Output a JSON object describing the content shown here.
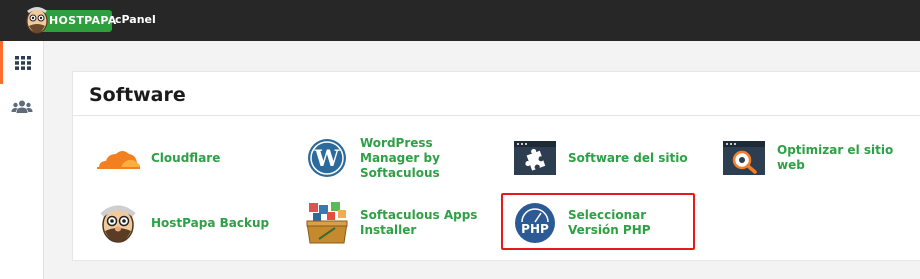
{
  "topbar": {
    "logo_text": "HOSTPAPA",
    "product": "cPanel"
  },
  "sidebar": {
    "items": [
      {
        "icon": "grid-icon",
        "active": true
      },
      {
        "icon": "users-icon",
        "active": false
      }
    ]
  },
  "section": {
    "title": "Software",
    "items": [
      {
        "label": "Cloudflare",
        "icon": "cloudflare-icon"
      },
      {
        "label": "WordPress Manager by Softaculous",
        "icon": "wordpress-icon"
      },
      {
        "label": "Software del sitio",
        "icon": "site-software-icon"
      },
      {
        "label": "Optimizar el sitio web",
        "icon": "optimize-website-icon"
      },
      {
        "label": "HostPapa Backup",
        "icon": "hostpapa-backup-icon"
      },
      {
        "label": "Softaculous Apps Installer",
        "icon": "softaculous-icon"
      },
      {
        "label": "Seleccionar Versión PHP",
        "icon": "php-icon",
        "highlighted": true
      }
    ]
  },
  "colors": {
    "topbar": "#272727",
    "accent_orange": "#ff6c2c",
    "link_green": "#2ea046",
    "highlight_red": "#e8191a"
  }
}
